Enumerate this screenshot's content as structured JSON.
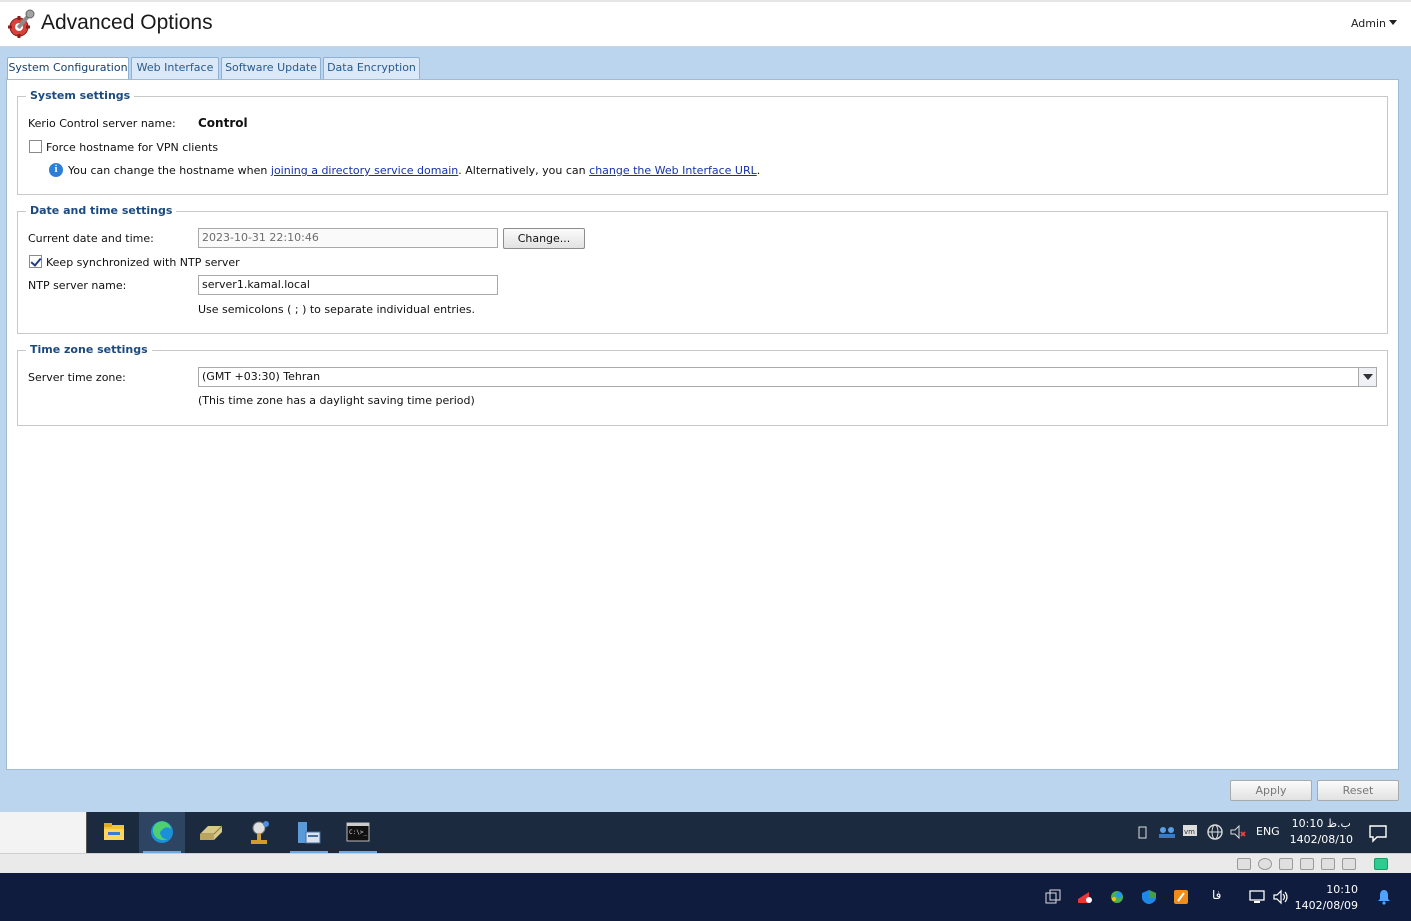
{
  "header": {
    "title": "Advanced Options",
    "user_menu": "Admin",
    "app_icon": "gear-tools-icon"
  },
  "tabs": [
    {
      "label": "System Configuration",
      "active": true
    },
    {
      "label": "Web Interface",
      "active": false
    },
    {
      "label": "Software Update",
      "active": false
    },
    {
      "label": "Data Encryption",
      "active": false
    }
  ],
  "system_settings": {
    "legend": "System settings",
    "server_name_label": "Kerio Control server name:",
    "server_name_value": "Control",
    "force_hostname_label": "Force hostname for VPN clients",
    "force_hostname_checked": false,
    "info_prefix": "You can change the hostname when ",
    "info_link1": "joining a directory service domain",
    "info_middle": ". Alternatively, you can ",
    "info_link2": "change the Web Interface URL",
    "info_suffix": "."
  },
  "date_time": {
    "legend": "Date and time settings",
    "current_label": "Current date and time:",
    "current_value": "2023-10-31 22:10:46",
    "change_button": "Change...",
    "ntp_sync_label": "Keep synchronized with NTP server",
    "ntp_sync_checked": true,
    "ntp_name_label": "NTP server name:",
    "ntp_name_value": "server1.kamal.local",
    "ntp_hint": "Use semicolons ( ; ) to separate individual entries."
  },
  "time_zone": {
    "legend": "Time zone settings",
    "zone_label": "Server time zone:",
    "zone_value": "(GMT +03:30) Tehran",
    "zone_hint": "(This time zone has a daylight saving time period)"
  },
  "footer": {
    "apply_button": "Apply",
    "reset_button": "Reset"
  },
  "taskbar_vm": {
    "apps": [
      "file-explorer-icon",
      "edge-browser-icon",
      "drive-icon",
      "network-tool-icon",
      "server-manager-icon",
      "terminal-icon"
    ],
    "language": "ENG",
    "time": "10:10 ب.ظ",
    "date": "1402/08/10"
  },
  "taskbar_host": {
    "language": "فا",
    "time": "10:10",
    "date": "1402/08/09"
  }
}
